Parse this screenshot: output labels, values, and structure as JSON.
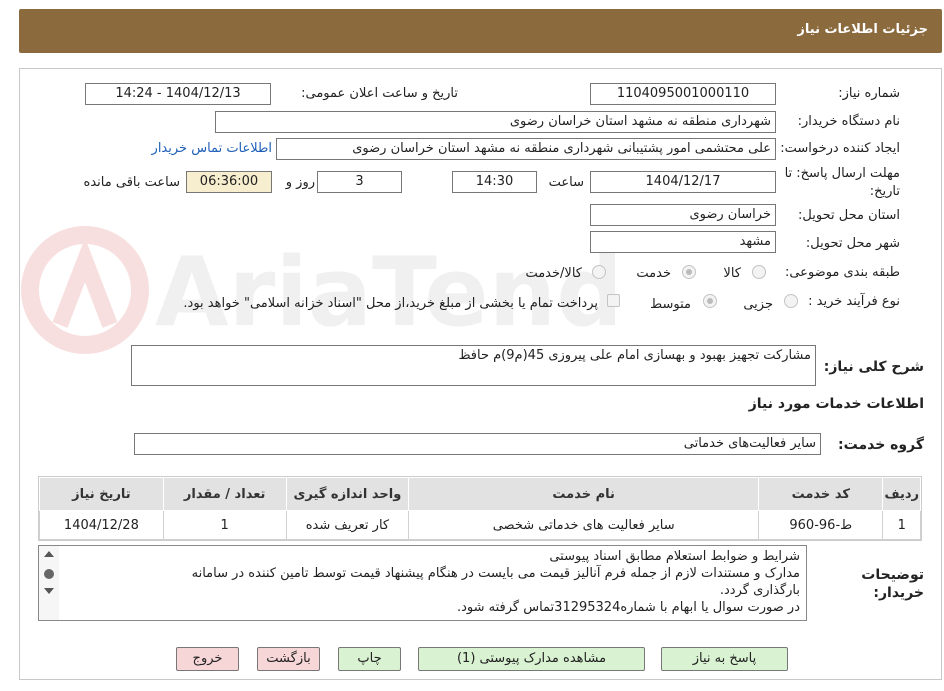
{
  "header": {
    "title": "جزئیات اطلاعات نیاز"
  },
  "fields": {
    "need_number_label": "شماره نیاز:",
    "need_number": "1104095001000110",
    "announce_label": "تاریخ و ساعت اعلان عمومی:",
    "announce_value": "1404/12/13 - 14:24",
    "buyer_org_label": "نام دستگاه خریدار:",
    "buyer_org": "شهرداری منطقه نه مشهد استان خراسان رضوی",
    "creator_label": "ایجاد کننده درخواست:",
    "creator": "علی محتشمی امور پشتیبانی شهرداری منطقه نه مشهد استان خراسان رضوی",
    "contact_link": "اطلاعات تماس خریدار",
    "deadline_label_1": "مهلت ارسال پاسخ: تا",
    "deadline_label_2": "تاریخ:",
    "deadline_date": "1404/12/17",
    "time_label": "ساعت",
    "deadline_time": "14:30",
    "days": "3",
    "days_label": "روز و",
    "remaining": "06:36:00",
    "remaining_label": "ساعت باقی مانده",
    "province_label": "استان محل تحویل:",
    "province": "خراسان رضوی",
    "city_label": "شهر محل تحویل:",
    "city": "مشهد",
    "category_label": "طبقه بندی موضوعی:",
    "category_options": [
      "کالا",
      "خدمت",
      "کالا/خدمت"
    ],
    "process_label": "نوع فرآیند خرید :",
    "process_options": [
      "جزیی",
      "متوسط"
    ],
    "payment_note": "پرداخت تمام یا بخشی از مبلغ خرید،از محل \"اسناد خزانه اسلامی\" خواهد بود.",
    "summary_label": "شرح کلی نیاز:",
    "summary": "مشارکت تجهیز بهبود و بهسازی امام علی پیروزی 45(م9)م حافظ",
    "services_heading": "اطلاعات خدمات مورد نیاز",
    "service_group_label": "گروه خدمت:",
    "service_group": "سایر فعالیت‌های خدماتی",
    "buyer_notes_label_1": "توضیحات",
    "buyer_notes_label_2": "خریدار:"
  },
  "table": {
    "headers": [
      "ردیف",
      "کد خدمت",
      "نام خدمت",
      "واحد اندازه گیری",
      "تعداد / مقدار",
      "تاریخ نیاز"
    ],
    "rows": [
      [
        "1",
        "ط-96-960",
        "سایر فعالیت های خدماتی شخصی",
        "کار تعریف شده",
        "1",
        "1404/12/28"
      ]
    ]
  },
  "notes": {
    "line1": "شرایط و ضوابط استعلام مطابق اسناد پیوستی",
    "line2": "مدارک و مستندات لازم از جمله فرم آنالیز قیمت می بایست در هنگام پیشنهاد قیمت توسط تامین کننده در سامانه",
    "line3": "بارگذاری گردد.",
    "line4": "در صورت سوال یا ابهام با شماره31295324تماس گرفته شود."
  },
  "buttons": {
    "reply": "پاسخ به نیاز",
    "attachments": "مشاهده مدارک پیوستی (1)",
    "print": "چاپ",
    "back": "بازگشت",
    "exit": "خروج"
  },
  "colors": {
    "header_bg": "#8b6b3e",
    "button_green": "#d9f2d2",
    "button_pink": "#f6d6d6",
    "countdown_bg": "#f6eecf"
  }
}
